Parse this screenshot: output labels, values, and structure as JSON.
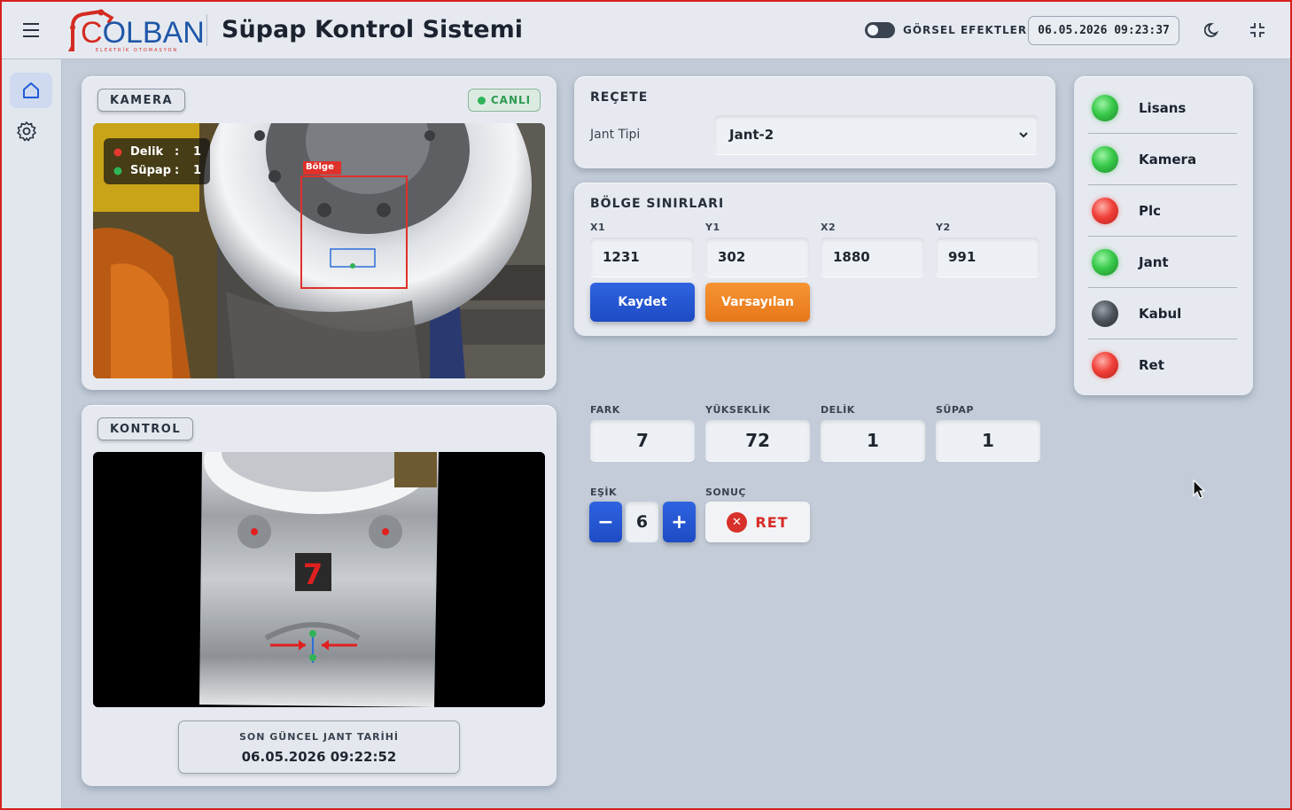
{
  "header": {
    "logo_text_c": "C",
    "logo_text_rest": "OLBAN",
    "logo_subtitle": "ELEKTRİK OTOMASYON",
    "title": "Süpap Kontrol Sistemi",
    "visual_effects_label": "GÖRSEL EFEKTLER",
    "datetime": "06.05.2026 09:23:37"
  },
  "sidebar": {
    "items": [
      {
        "icon": "home-icon",
        "active": true
      },
      {
        "icon": "gear-icon",
        "active": false
      }
    ]
  },
  "camera": {
    "label": "KAMERA",
    "live_label": "CANLI",
    "overlay": {
      "hole_label": "Delik",
      "hole_value": "1",
      "valve_label": "Süpap",
      "valve_value": "1",
      "region_label": "Bölge"
    }
  },
  "control": {
    "label": "KONTROL",
    "marker_value": "7",
    "last_date_label": "SON GÜNCEL JANT TARİHİ",
    "last_date_value": "06.05.2026 09:22:52"
  },
  "recipe": {
    "title": "REÇETE",
    "rim_type_label": "Jant Tipi",
    "rim_type_value": "Jant-2"
  },
  "region_limits": {
    "title": "BÖLGE SINIRLARI",
    "fields": [
      {
        "label": "X1",
        "value": "1231"
      },
      {
        "label": "Y1",
        "value": "302"
      },
      {
        "label": "X2",
        "value": "1880"
      },
      {
        "label": "Y2",
        "value": "991"
      }
    ],
    "save_label": "Kaydet",
    "default_label": "Varsayılan"
  },
  "metrics": [
    {
      "label": "FARK",
      "value": "7"
    },
    {
      "label": "YÜKSEKLİK",
      "value": "72"
    },
    {
      "label": "DELİK",
      "value": "1"
    },
    {
      "label": "SÜPAP",
      "value": "1"
    }
  ],
  "threshold": {
    "label": "EŞİK",
    "value": "6",
    "minus": "−",
    "plus": "+"
  },
  "result": {
    "label": "SONUÇ",
    "value": "RET",
    "color": "#d82a26"
  },
  "status": [
    {
      "name": "Lisans",
      "state": "green"
    },
    {
      "name": "Kamera",
      "state": "green"
    },
    {
      "name": "Plc",
      "state": "red"
    },
    {
      "name": "Jant",
      "state": "green"
    },
    {
      "name": "Kabul",
      "state": "gray"
    },
    {
      "name": "Ret",
      "state": "red"
    }
  ],
  "colors": {
    "accent_blue": "#1d4bc4",
    "accent_orange": "#e8781a",
    "status_green": "#38c94a",
    "status_red": "#f0413a",
    "brand_red": "#d42b22",
    "brand_blue": "#1f57a8"
  }
}
